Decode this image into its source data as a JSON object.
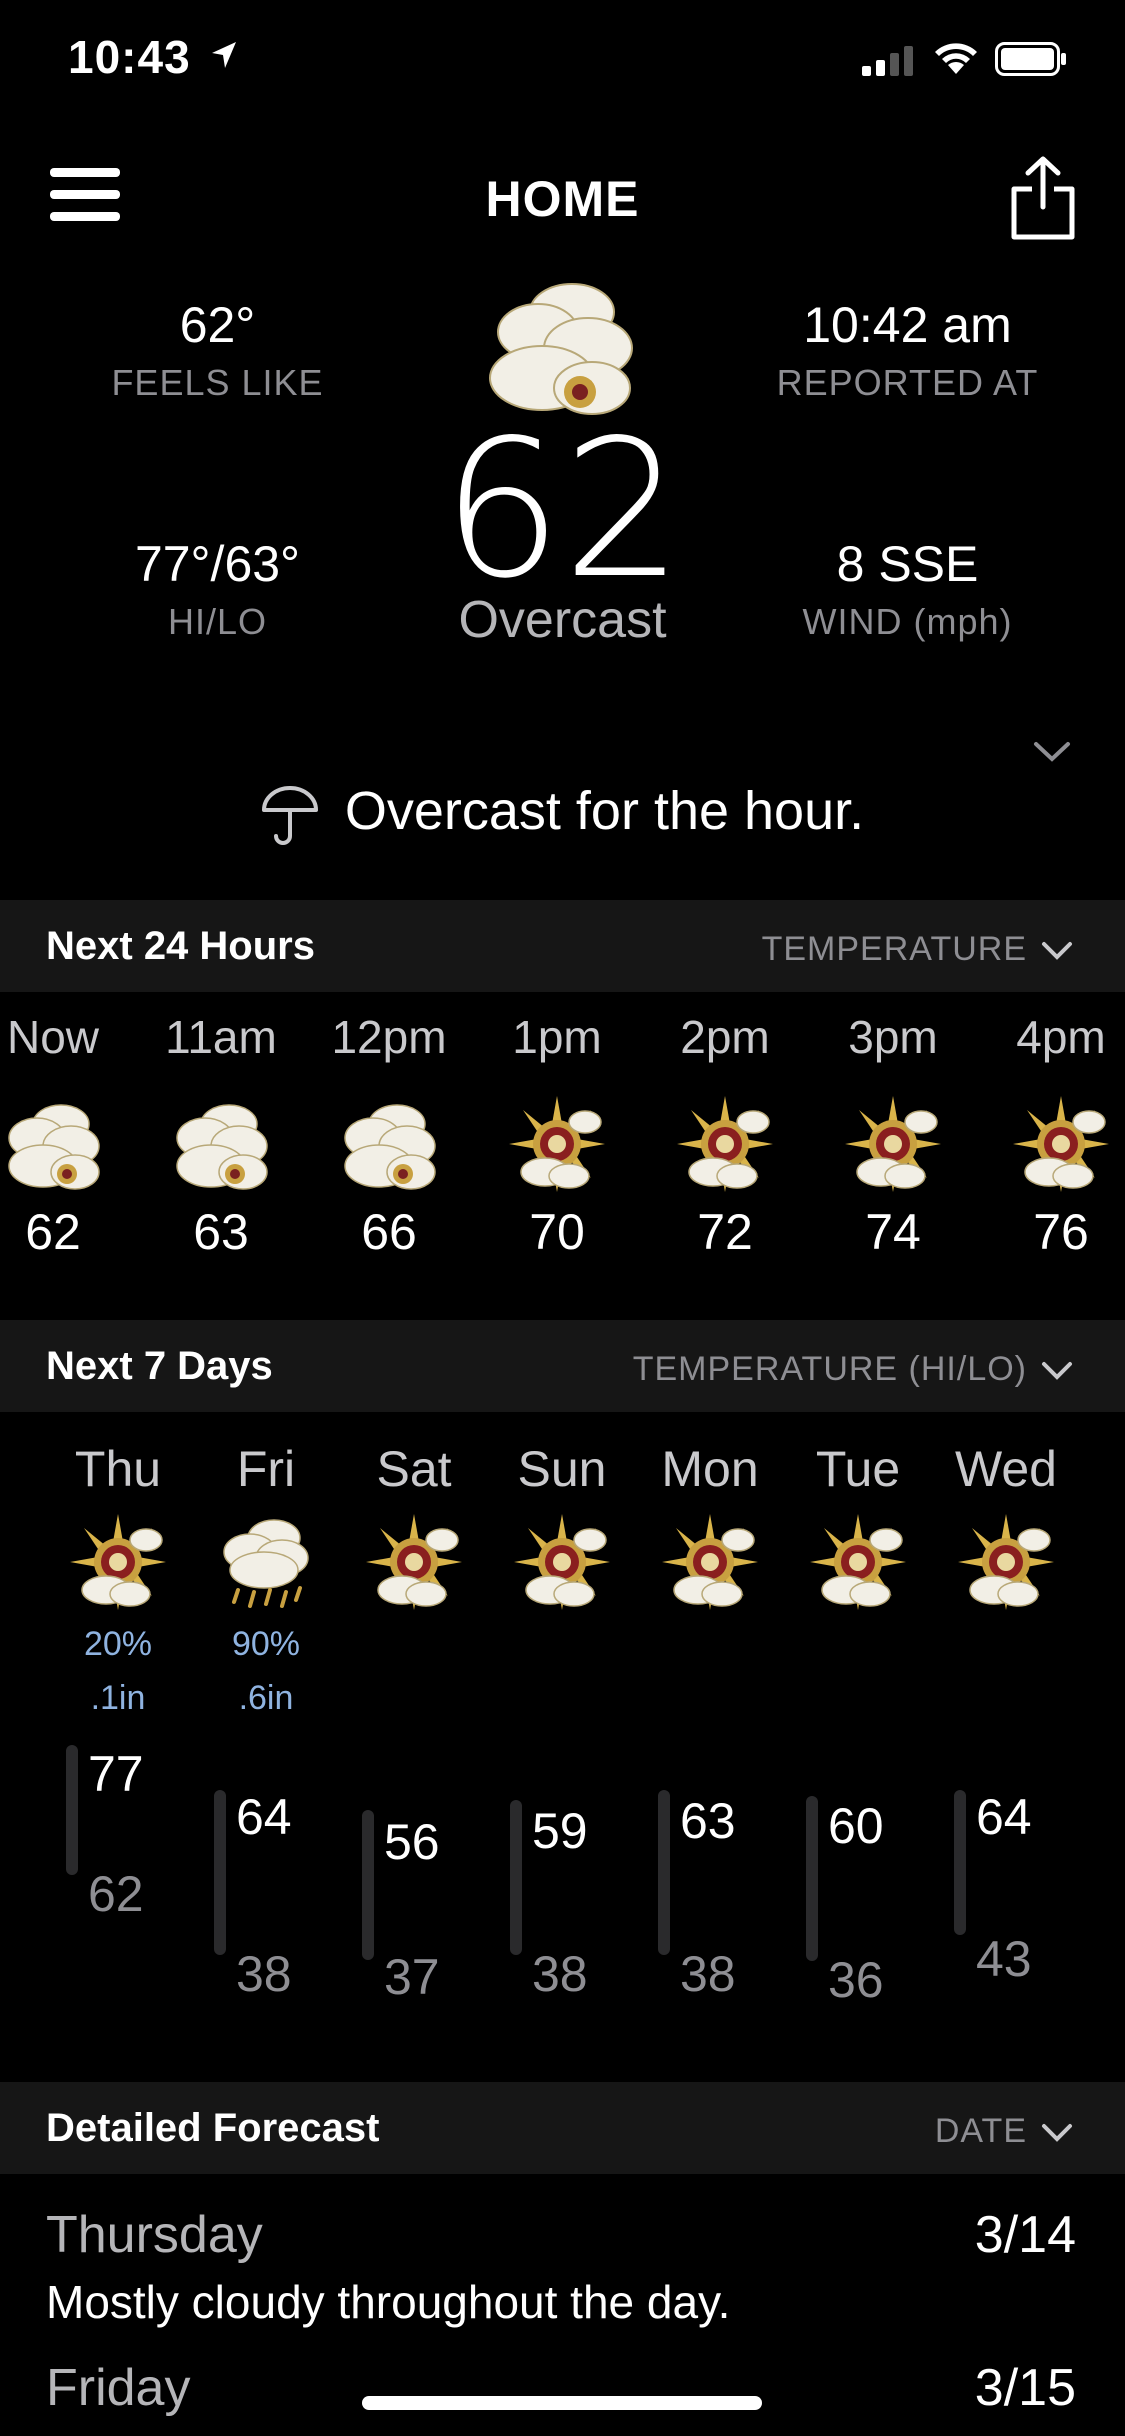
{
  "status_bar": {
    "time": "10:43"
  },
  "header": {
    "title": "HOME"
  },
  "current": {
    "feels_like_value": "62°",
    "feels_like_label": "FEELS LIKE",
    "reported_value": "10:42 am",
    "reported_label": "REPORTED AT",
    "hilo_value": "77°/63°",
    "hilo_label": "HI/LO",
    "wind_value": "8 SSE",
    "wind_label": "WIND (mph)",
    "temperature": "62",
    "condition": "Overcast",
    "summary": "Overcast for the hour.",
    "icon": "cloud-icon"
  },
  "hourly_section": {
    "title": "Next 24 Hours",
    "selector": "TEMPERATURE",
    "hours": [
      {
        "time": "Now",
        "temp": "62",
        "icon": "cloud-icon"
      },
      {
        "time": "11am",
        "temp": "63",
        "icon": "cloud-icon"
      },
      {
        "time": "12pm",
        "temp": "66",
        "icon": "cloud-icon"
      },
      {
        "time": "1pm",
        "temp": "70",
        "icon": "partly-cloudy-icon"
      },
      {
        "time": "2pm",
        "temp": "72",
        "icon": "partly-cloudy-icon"
      },
      {
        "time": "3pm",
        "temp": "74",
        "icon": "partly-cloudy-icon"
      },
      {
        "time": "4pm",
        "temp": "76",
        "icon": "partly-cloudy-icon"
      }
    ]
  },
  "daily_section": {
    "title": "Next 7 Days",
    "selector": "TEMPERATURE (HI/LO)",
    "days": [
      {
        "name": "Thu",
        "icon": "partly-cloudy-icon",
        "precip_chance": "20%",
        "precip_amount": ".1in",
        "hi": "77",
        "lo": "62"
      },
      {
        "name": "Fri",
        "icon": "rain-icon",
        "precip_chance": "90%",
        "precip_amount": ".6in",
        "hi": "64",
        "lo": "38"
      },
      {
        "name": "Sat",
        "icon": "partly-cloudy-icon",
        "precip_chance": "",
        "precip_amount": "",
        "hi": "56",
        "lo": "37"
      },
      {
        "name": "Sun",
        "icon": "partly-cloudy-icon",
        "precip_chance": "",
        "precip_amount": "",
        "hi": "59",
        "lo": "38"
      },
      {
        "name": "Mon",
        "icon": "partly-cloudy-icon",
        "precip_chance": "",
        "precip_amount": "",
        "hi": "63",
        "lo": "38"
      },
      {
        "name": "Tue",
        "icon": "partly-cloudy-icon",
        "precip_chance": "",
        "precip_amount": "",
        "hi": "60",
        "lo": "36"
      },
      {
        "name": "Wed",
        "icon": "partly-cloudy-icon",
        "precip_chance": "",
        "precip_amount": "",
        "hi": "64",
        "lo": "43"
      }
    ]
  },
  "detailed_section": {
    "title": "Detailed Forecast",
    "selector": "DATE",
    "entries": [
      {
        "day": "Thursday",
        "date": "3/14",
        "text": "Mostly cloudy throughout the day."
      },
      {
        "day": "Friday",
        "date": "3/15",
        "text": ""
      }
    ]
  }
}
